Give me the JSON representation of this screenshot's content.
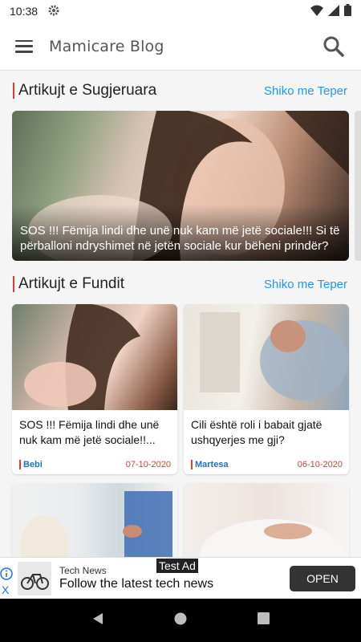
{
  "status": {
    "time": "10:38"
  },
  "appbar": {
    "title": "Mamicare Blog"
  },
  "suggested": {
    "heading": "Artikujt e Sugjeruara",
    "more": "Shiko me Teper",
    "hero_title": "SOS !!! Fëmija lindi dhe unë nuk kam më jetë sociale!!! Si të përballoni ndryshimet në jetën sociale kur bëheni prindër?"
  },
  "latest": {
    "heading": "Artikujt e Fundit",
    "more": "Shiko me Teper",
    "cards": [
      {
        "title": "SOS !!! Fëmija lindi dhe unë nuk kam më jetë sociale!!...",
        "author": "Bebi",
        "date": "07-10-2020"
      },
      {
        "title": "Cili është roli i babait gjatë ushqyerjes me gji?",
        "author": "Martesa",
        "date": "06-10-2020"
      }
    ]
  },
  "ad": {
    "tag": "Test Ad",
    "brand": "Tech News",
    "headline": "Follow the latest tech news",
    "cta": "OPEN",
    "close": "X"
  },
  "colors": {
    "accent": "#e53935",
    "link": "#2196f3"
  }
}
